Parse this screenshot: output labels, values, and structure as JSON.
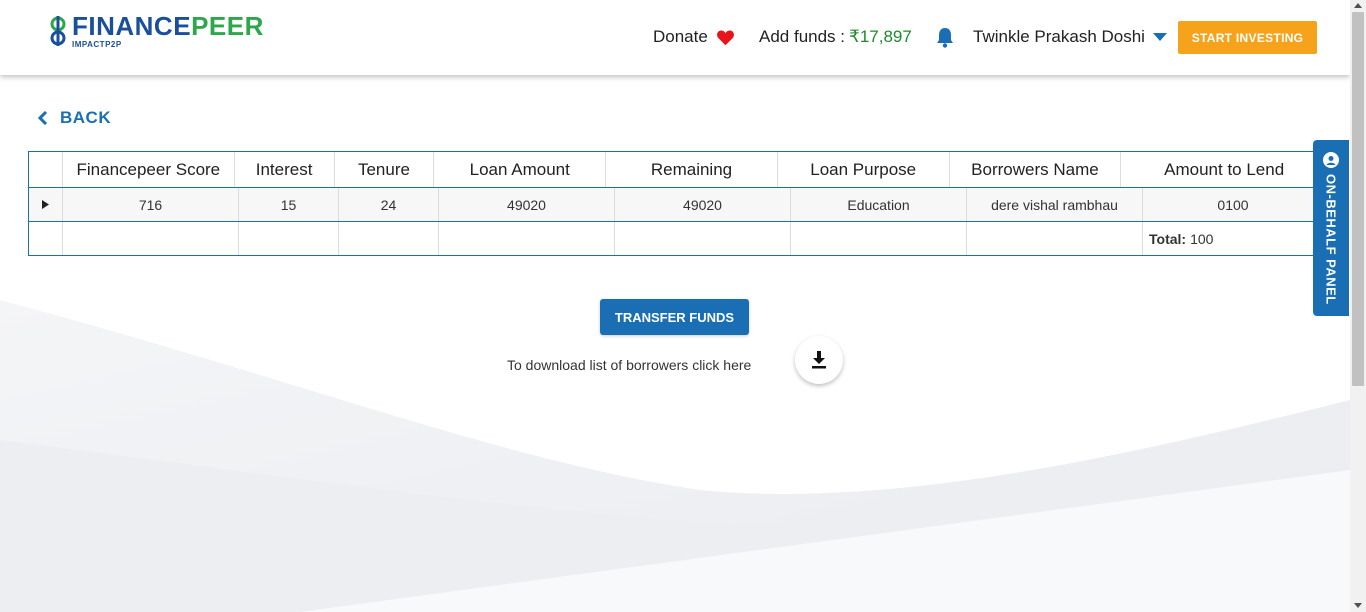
{
  "header": {
    "logo": {
      "brand_part1": "FINANCE",
      "brand_part2": "PEER",
      "tagline": "IMPACTP2P"
    },
    "donate_label": "Donate",
    "add_funds_label": "Add funds :",
    "add_funds_amount": "₹17,897",
    "user_name": "Twinkle Prakash Doshi",
    "start_investing_label": "START INVESTING"
  },
  "back_label": "BACK",
  "table": {
    "columns": [
      "Financepeer Score",
      "Interest",
      "Tenure",
      "Loan Amount",
      "Remaining",
      "Loan Purpose",
      "Borrowers Name",
      "Amount to Lend"
    ],
    "rows": [
      [
        "716",
        "15",
        "24",
        "49020",
        "49020",
        "Education",
        "dere vishal rambhau",
        "0100"
      ]
    ],
    "total_label": "Total:",
    "total_value": "100"
  },
  "transfer_button_label": "TRANSFER FUNDS",
  "download_text": "To download list of borrowers click here",
  "side_panel_label": "ON-BEHALF PANEL",
  "colors": {
    "primary": "#1a6fb4",
    "accent": "#f7a21b",
    "funds_green": "#1e8a2c",
    "heart": "#e8141c"
  },
  "icons": [
    "heart-icon",
    "bell-icon",
    "caret-down-icon",
    "chevron-left-icon",
    "expand-row-icon",
    "download-icon",
    "support-icon"
  ]
}
